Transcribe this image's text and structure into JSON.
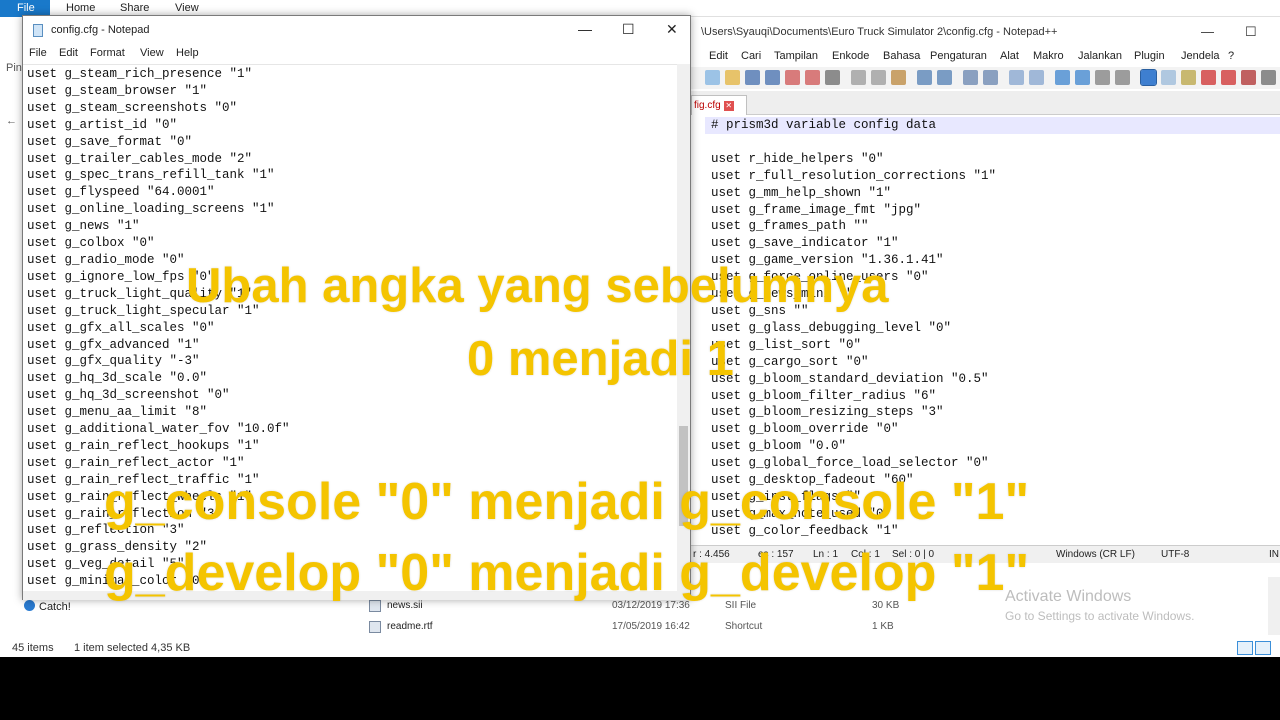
{
  "explorer": {
    "ribbon_tabs": [
      "File",
      "Home",
      "Share",
      "View"
    ],
    "side_frags": [
      "Pin",
      "←"
    ],
    "files": [
      {
        "name": "news.sii",
        "date": "03/12/2019 17:36",
        "type": "SII File",
        "size": "30 KB"
      },
      {
        "name": "readme.rtf",
        "date": "17/05/2019 16:42",
        "type": "Shortcut",
        "size": "1 KB"
      }
    ],
    "pinned_item": "Catch!",
    "status": {
      "count": "45 items",
      "selected": "1 item selected  4,35 KB"
    }
  },
  "notepadpp": {
    "title": "\\Users\\Syauqi\\Documents\\Euro Truck Simulator 2\\config.cfg - Notepad++",
    "menu": [
      "Edit",
      "Cari",
      "Tampilan",
      "Enkode",
      "Bahasa",
      "Pengaturan",
      "Alat",
      "Makro",
      "Jalankan",
      "Plugin",
      "Jendela",
      "?"
    ],
    "tab": "fig.cfg",
    "lines": [
      "# prism3d variable config data",
      "",
      "uset r_hide_helpers \"0\"",
      "uset r_full_resolution_corrections \"1\"",
      "uset g_mm_help_shown \"1\"",
      "uset g_frame_image_fmt \"jpg\"",
      "uset g_frames_path \"\"",
      "uset g_save_indicator \"1\"",
      "uset g_game_version \"1.36.1.41\"",
      "uset g_force_online_users \"0\"",
      "uset g_news_mini \"\"",
      "uset g_sns \"\"",
      "uset g_glass_debugging_level \"0\"",
      "uset g_list_sort \"0\"",
      "uset g_cargo_sort \"0\"",
      "uset g_bloom_standard_deviation \"0.5\"",
      "uset g_bloom_filter_radius \"6\"",
      "uset g_bloom_resizing_steps \"3\"",
      "uset g_bloom_override \"0\"",
      "uset g_bloom \"0.0\"",
      "uset g_global_force_load_selector \"0\"",
      "uset g_desktop_fadeout \"60\"",
      "uset g_inst_flags \"\"",
      "uset g_max_note_used \"0\"",
      "uset g_color_feedback \"1\""
    ],
    "status": {
      "length": "r : 4.456",
      "lines": "es : 157",
      "ln": "Ln : 1",
      "col": "Col : 1",
      "sel": "Sel : 0 | 0",
      "eol": "Windows (CR LF)",
      "enc": "UTF-8",
      "ins": "IN"
    }
  },
  "activate_windows": {
    "title": "Activate Windows",
    "subtitle": "Go to Settings to activate Windows."
  },
  "notepad": {
    "title": "config.cfg - Notepad",
    "menu": [
      "File",
      "Edit",
      "Format",
      "View",
      "Help"
    ],
    "window_buttons": {
      "minimize": "—",
      "maximize": "☐",
      "close": "✕"
    },
    "lines": [
      "uset g_steam_rich_presence \"1\"",
      "uset g_steam_browser \"1\"",
      "uset g_steam_screenshots \"0\"",
      "uset g_artist_id \"0\"",
      "uset g_save_format \"0\"",
      "uset g_trailer_cables_mode \"2\"",
      "uset g_spec_trans_refill_tank \"1\"",
      "uset g_flyspeed \"64.0001\"",
      "uset g_online_loading_screens \"1\"",
      "uset g_news \"1\"",
      "uset g_colbox \"0\"",
      "uset g_radio_mode \"0\"",
      "uset g_ignore_low_fps \"0\"",
      "uset g_truck_light_quality \"1\"",
      "uset g_truck_light_specular \"1\"",
      "uset g_gfx_all_scales \"0\"",
      "uset g_gfx_advanced \"1\"",
      "uset g_gfx_quality \"-3\"",
      "uset g_hq_3d_scale \"0.0\"",
      "uset g_hq_3d_screenshot \"0\"",
      "uset g_menu_aa_limit \"8\"",
      "uset g_additional_water_fov \"10.0f\"",
      "uset g_rain_reflect_hookups \"1\"",
      "uset g_rain_reflect_actor \"1\"",
      "uset g_rain_reflect_traffic \"1\"",
      "uset g_rain_reflect_wheels \"1\"",
      "uset g_rain_reflection \"3\"",
      "uset g_reflection \"3\"",
      "uset g_grass_density \"2\"",
      "uset g_veg_detail \"5\"",
      "uset g_minimap_color \"0\""
    ]
  },
  "overlay": {
    "line1": "Ubah angka yang sebelumnya",
    "line2": "0 menjadi 1",
    "line3": "g_console \"0\" menjadi g_console \"1\"",
    "line4": "g_develop \"0\" menjadi g_develop \"1\""
  },
  "colors": {
    "caption": "#f4c400",
    "current_line": "#e8e8ff",
    "explorer_file_tab": "#1979ca"
  }
}
